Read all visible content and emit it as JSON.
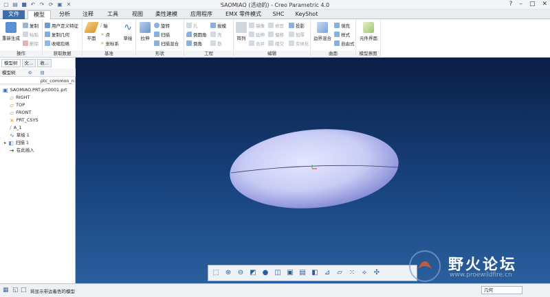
{
  "window": {
    "title": "SAOMIAO (活动的) - Creo Parametric 4.0",
    "controls": [
      "?",
      "–",
      "□",
      "✕"
    ]
  },
  "tabs": [
    "文件",
    "模型",
    "分析",
    "注释",
    "工具",
    "视图",
    "柔性建模",
    "应用程序",
    "EMX 零件模式",
    "SHC",
    "KeyShot"
  ],
  "active_tab": "模型",
  "ribbon": {
    "operations": {
      "label": "操作",
      "regen": "重新生成",
      "copy": "复制",
      "paste": "粘贴",
      "delete": "删除"
    },
    "get_data": {
      "label": "获取数据",
      "udf": "用户定义特征",
      "copy_geom": "复制几何",
      "shrinkwrap": "收缩包络"
    },
    "datum": {
      "label": "基准",
      "plane": "平面",
      "axis": "轴",
      "point": "点",
      "csys": "坐标系",
      "sketch": "草绘"
    },
    "shapes": {
      "label": "形状",
      "extrude": "拉伸",
      "revolve": "旋转",
      "sweep": "扫描",
      "swept_blend": "扫描混合"
    },
    "engineering": {
      "label": "工程",
      "hole": "孔",
      "round": "倒圆角",
      "chamfer": "倒角",
      "draft": "拔模",
      "shell": "壳",
      "rib": "筋"
    },
    "editing": {
      "label": "编辑",
      "pattern": "阵列",
      "mirror": "镜像",
      "extend": "延伸",
      "merge": "合并",
      "trim": "修剪",
      "offset": "偏移",
      "intersect": "相交",
      "project": "投影",
      "thicken": "加厚",
      "solidify": "实体化"
    },
    "surfaces": {
      "label": "曲面",
      "boundary_blend": "边界混合",
      "fill": "填充",
      "style": "样式",
      "freestyle": "自由式"
    },
    "model_intent": {
      "label": "模型意图",
      "component_interface": "元件界面"
    }
  },
  "left_panel": {
    "tabs": [
      "模型树",
      "文...",
      "收..."
    ],
    "toolbar_label": "模型树",
    "column_header": "ptc_common_n",
    "tree": [
      {
        "label": "SAOMIAO.PRT.prt0001.prt",
        "icon": "part-icon",
        "indent": 0
      },
      {
        "label": "RIGHT",
        "icon": "datum-plane-icon",
        "indent": 1
      },
      {
        "label": "TOP",
        "icon": "datum-plane-icon",
        "indent": 1
      },
      {
        "label": "FRONT",
        "icon": "datum-plane-icon",
        "indent": 1
      },
      {
        "label": "PRT_CSYS",
        "icon": "csys-icon",
        "indent": 1
      },
      {
        "label": "A_1",
        "icon": "axis-icon",
        "indent": 1
      },
      {
        "label": "草绘 1",
        "icon": "sketch-icon",
        "indent": 1
      },
      {
        "label": "扫描 1",
        "icon": "sweep-icon",
        "indent": 1
      },
      {
        "label": "在此插入",
        "icon": "insert-here-icon",
        "indent": 1
      }
    ]
  },
  "status": {
    "message": "将显示带边着色的模型",
    "filter": "几何"
  },
  "watermark": {
    "text": "野火论坛",
    "url": "www.proewildfire.cn"
  },
  "colors": {
    "file_tab": "#3b6dab",
    "viewport_top": "#0a1e45",
    "viewport_bottom": "#2a5f9d",
    "model": "#c9cdf5"
  }
}
